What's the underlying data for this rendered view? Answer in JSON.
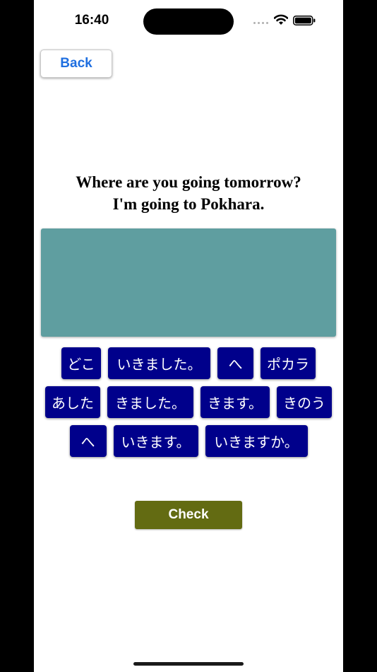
{
  "status_bar": {
    "time": "16:40"
  },
  "navigation": {
    "back_label": "Back"
  },
  "prompt": {
    "line1": "Where are you going tomorrow?",
    "line2": "I'm going to Pokhara."
  },
  "word_bank": {
    "row1": [
      "どこ",
      "いきました。",
      "へ",
      "ポカラ"
    ],
    "row2": [
      "あした",
      "きました。",
      "きます。",
      "きのう"
    ],
    "row3": [
      "へ",
      "いきます。",
      "いきますか。"
    ]
  },
  "actions": {
    "check_label": "Check"
  },
  "colors": {
    "answer_area": "#5f9ea0",
    "tile_background": "#00008b",
    "check_button": "#636b12",
    "back_text": "#1f6fe0"
  },
  "icons": {
    "signal": "cellular-signal-icon",
    "wifi": "wifi-icon",
    "battery": "battery-icon"
  }
}
